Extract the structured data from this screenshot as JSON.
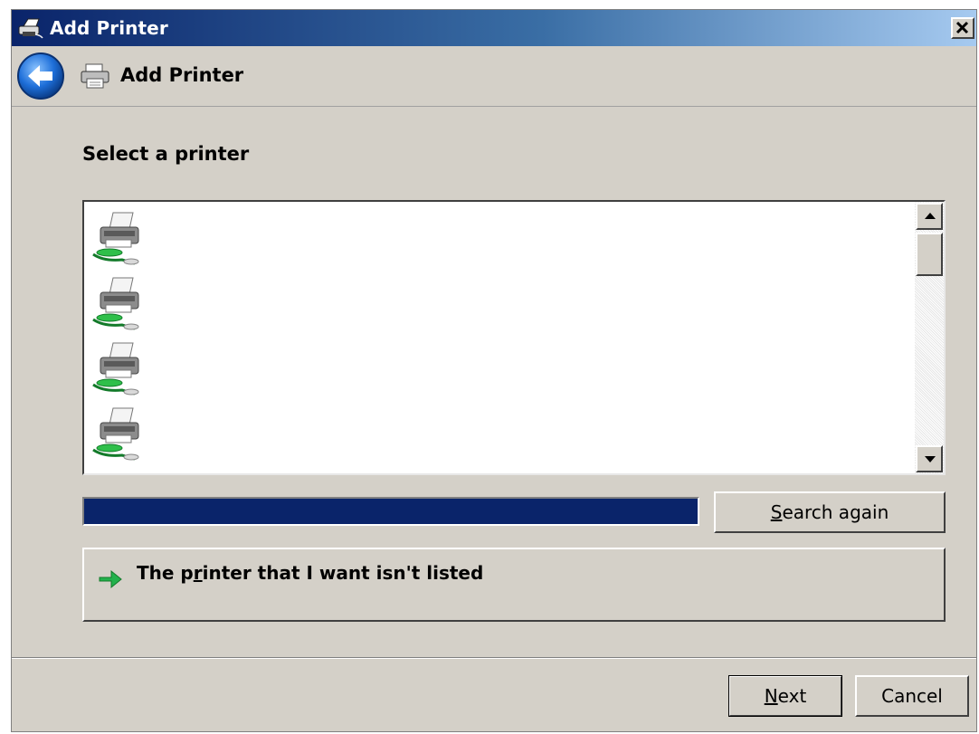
{
  "window": {
    "title": "Add Printer",
    "close_label": "x"
  },
  "header": {
    "title": "Add Printer"
  },
  "content": {
    "section_title": "Select a printer",
    "printers": [
      {
        "icon": "network-printer-icon"
      },
      {
        "icon": "network-printer-icon"
      },
      {
        "icon": "network-printer-icon"
      },
      {
        "icon": "network-printer-icon"
      }
    ],
    "search_progress": 1.0
  },
  "buttons": {
    "search_again": {
      "pre": "",
      "key": "S",
      "post": "earch again"
    },
    "next": {
      "pre": "",
      "key": "N",
      "post": "ext"
    },
    "cancel": "Cancel"
  },
  "link": {
    "pre": "The p",
    "key": "r",
    "post": "inter that I want isn't listed"
  },
  "colors": {
    "progress_fill": "#0a246a",
    "link_arrow": "#22b14c",
    "back_button": "#1e6fd9"
  }
}
